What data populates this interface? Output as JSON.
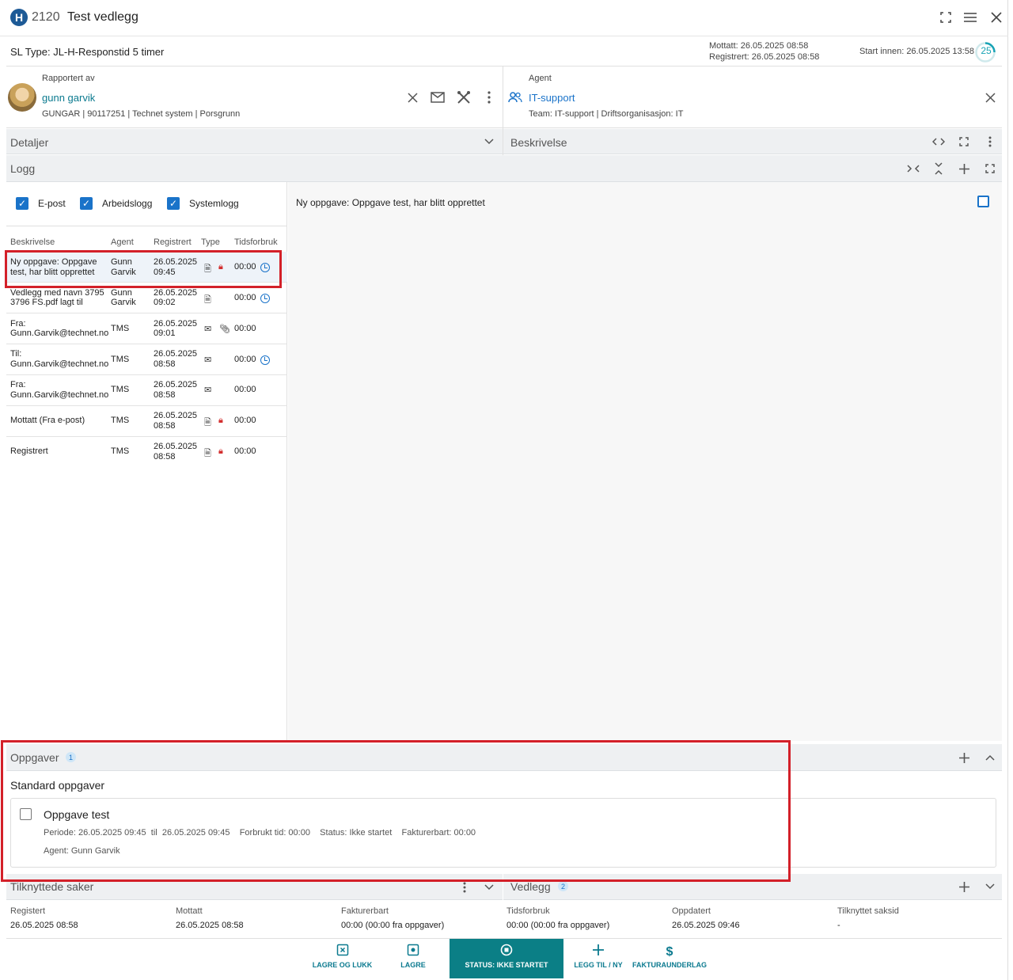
{
  "window": {
    "logo": "H",
    "case_number": "2120",
    "title": "Test vedlegg",
    "icons": [
      "fullscreen-icon",
      "menu-icon",
      "close-icon"
    ]
  },
  "sl": {
    "type": "SL Type: JL-H-Responstid 5 timer",
    "mottatt": "Mottatt: 26.05.2025 08:58",
    "registrert": "Registrert: 26.05.2025 08:58",
    "start": "Start innen: 26.05.2025 13:58",
    "ring_value": "25"
  },
  "reporter": {
    "label": "Rapportert av",
    "name": "gunn garvik",
    "details": "GUNGAR | 90117251 | Technet system | Porsgrunn"
  },
  "agent": {
    "label": "Agent",
    "name": "IT-support",
    "details": "Team: IT-support | Driftsorganisasjon: IT"
  },
  "sections": {
    "detaljer": "Detaljer",
    "beskrivelse": "Beskrivelse",
    "logg": "Logg",
    "oppgaver": "Oppgaver",
    "oppgaver_count": "1",
    "tilknyttede": "Tilknyttede saker",
    "vedlegg": "Vedlegg",
    "vedlegg_count": "2"
  },
  "filters": [
    {
      "label": "E-post"
    },
    {
      "label": "Arbeidslogg"
    },
    {
      "label": "Systemlogg"
    }
  ],
  "log_headers": {
    "beskrivelse": "Beskrivelse",
    "agent": "Agent",
    "registrert": "Registrert",
    "type": "Type",
    "tid": "Tidsforbruk"
  },
  "log_rows": [
    {
      "desc1": "Ny oppgave: Oppgave",
      "desc2": "test, har blitt opprettet",
      "agent1": "Gunn",
      "agent2": "Garvik",
      "date": "26.05.2025",
      "time": "09:45",
      "tid": "00:00"
    },
    {
      "desc1": "Vedlegg med navn 3795",
      "desc2": "3796 FS.pdf lagt til",
      "agent1": "Gunn",
      "agent2": "Garvik",
      "date": "26.05.2025",
      "time": "09:02",
      "tid": "00:00"
    },
    {
      "desc1": "Fra:",
      "desc2": "Gunn.Garvik@technet.no",
      "agent1": "TMS",
      "agent2": "",
      "date": "26.05.2025",
      "time": "09:01",
      "tid": "00:00"
    },
    {
      "desc1": "Til:",
      "desc2": "Gunn.Garvik@technet.no",
      "agent1": "TMS",
      "agent2": "",
      "date": "26.05.2025",
      "time": "08:58",
      "tid": "00:00"
    },
    {
      "desc1": "Fra:",
      "desc2": "Gunn.Garvik@technet.no",
      "agent1": "TMS",
      "agent2": "",
      "date": "26.05.2025",
      "time": "08:58",
      "tid": "00:00"
    },
    {
      "desc1": "Mottatt (Fra e-post)",
      "desc2": "",
      "agent1": "TMS",
      "agent2": "",
      "date": "26.05.2025",
      "time": "08:58",
      "tid": "00:00"
    },
    {
      "desc1": "Registrert",
      "desc2": "",
      "agent1": "TMS",
      "agent2": "",
      "date": "26.05.2025",
      "time": "08:58",
      "tid": "00:00"
    }
  ],
  "detail_text": "Ny oppgave: Oppgave test, har blitt opprettet",
  "tasks": {
    "group": "Standard oppgaver",
    "title": "Oppgave test",
    "meta": "Periode: 26.05.2025 09:45  til  26.05.2025 09:45    Forbrukt tid: 00:00    Status: Ikke startet    Fakturerbart: 00:00",
    "agent": "Agent: Gunn Garvik"
  },
  "info": [
    {
      "k": "Registert",
      "v": "26.05.2025 08:58"
    },
    {
      "k": "Mottatt",
      "v": "26.05.2025 08:58"
    },
    {
      "k": "Fakturerbart",
      "v": "00:00 (00:00 fra oppgaver)"
    },
    {
      "k": "Tidsforbruk",
      "v": "00:00 (00:00 fra oppgaver)"
    },
    {
      "k": "Oppdatert",
      "v": "26.05.2025 09:46"
    },
    {
      "k": "Tilknyttet saksid",
      "v": "-"
    }
  ],
  "footer": {
    "lagre_lukk": "LAGRE OG LUKK",
    "lagre": "LAGRE",
    "status": "STATUS: IKKE STARTET",
    "legg_til": "LEGG TIL / NY",
    "faktura": "FAKTURAUNDERLAG"
  }
}
